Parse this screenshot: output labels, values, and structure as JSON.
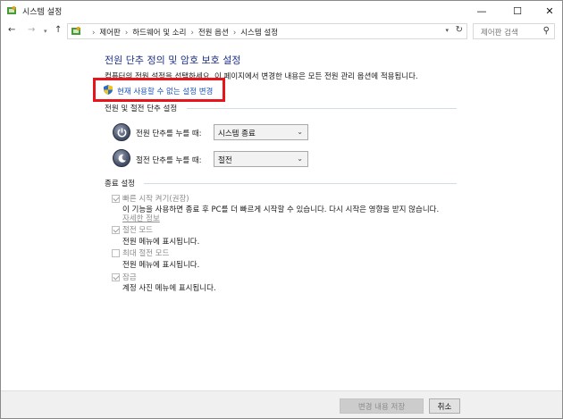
{
  "window": {
    "title": "시스템 설정"
  },
  "title_buttons": {
    "minimize": "—",
    "maximize": "☐",
    "close": "✕"
  },
  "nav": {
    "back": "←",
    "forward": "→",
    "up": "↑",
    "breadcrumb": [
      "제어판",
      "하드웨어 및 소리",
      "전원 옵션",
      "시스템 설정"
    ],
    "search_placeholder": "제어판 검색"
  },
  "content": {
    "title": "전원 단추 정의 및 암호 보호 설정",
    "description": "컴퓨터의 전원 설정을 선택하세요. 이 페이지에서 변경한 내용은 모든 전원 관리 옵션에 적용됩니다.",
    "change_link": "현재 사용할 수 없는 설정 변경",
    "highlight_color": "#e8141b"
  },
  "power_section": {
    "heading": "전원 및 절전 단추 설정",
    "rows": [
      {
        "label": "전원 단추를 누를 때:",
        "value": "시스템 종료"
      },
      {
        "label": "절전 단추를 누를 때:",
        "value": "절전"
      }
    ]
  },
  "shutdown_section": {
    "heading": "종료 설정",
    "options": [
      {
        "label": "빠른 시작 켜기(권장)",
        "checked": true,
        "desc": "이 기능을 사용하면 종료 후 PC를 더 빠르게 시작할 수 있습니다. 다시 시작은 영향을 받지 않습니다.",
        "link": "자세한 정보"
      },
      {
        "label": "절전 모드",
        "checked": true,
        "desc": "전원 메뉴에 표시됩니다."
      },
      {
        "label": "최대 절전 모드",
        "checked": false,
        "desc": "전원 메뉴에 표시됩니다."
      },
      {
        "label": "잠금",
        "checked": true,
        "desc": "계정 사진 메뉴에 표시됩니다."
      }
    ]
  },
  "footer": {
    "save": "변경 내용 저장",
    "cancel": "취소"
  }
}
